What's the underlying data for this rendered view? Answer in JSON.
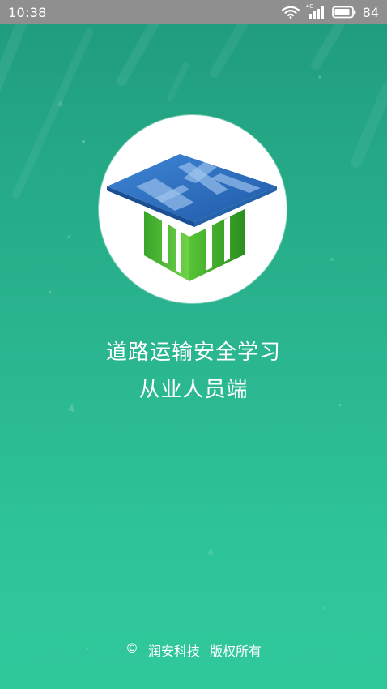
{
  "status_bar": {
    "time": "10:38",
    "network_type": "4G",
    "battery_level": "84",
    "icons": [
      "wifi-icon",
      "cellular-signal-icon",
      "battery-icon"
    ]
  },
  "splash": {
    "logo_icon": "graduation-cap-an-logo-icon",
    "title_line_1": "道路运输安全学习",
    "title_line_2": "从业人员端"
  },
  "footer": {
    "copyright_symbol": "©",
    "company": "润安科技",
    "rights": "版权所有"
  },
  "colors": {
    "status_bar": "#8f8f8f",
    "background_top": "#1f9a7d",
    "background_bottom": "#2fc89b",
    "logo_blue": "#2f6fbe",
    "logo_green": "#4cb82e"
  }
}
